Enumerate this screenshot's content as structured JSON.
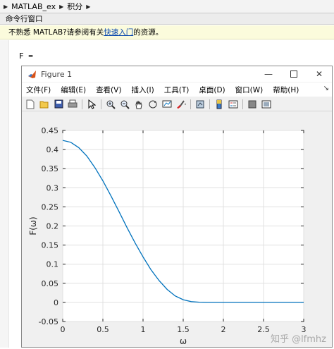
{
  "breadcrumb": {
    "items": [
      "MATLAB_ex",
      "积分"
    ]
  },
  "command_window": {
    "title": "命令行窗口",
    "hint_prefix": "不熟悉 MATLAB?请参阅有关",
    "hint_link": "快速入门",
    "hint_suffix": "的资源。",
    "output_line": "F ="
  },
  "figure": {
    "title": "Figure 1",
    "menu": [
      "文件(F)",
      "编辑(E)",
      "查看(V)",
      "插入(I)",
      "工具(T)",
      "桌面(D)",
      "窗口(W)",
      "帮助(H)"
    ],
    "toolbar_icons": [
      "new-file-icon",
      "open-icon",
      "save-icon",
      "print-icon",
      "pointer-icon",
      "zoom-in-icon",
      "zoom-out-icon",
      "pan-icon",
      "rotate-icon",
      "data-cursor-icon",
      "brush-icon",
      "link-plot-icon",
      "colorbar-icon",
      "legend-icon",
      "hide-plot-tools-icon",
      "show-plot-tools-icon"
    ]
  },
  "watermark": "知乎 @lfmhz",
  "colors": {
    "line": "#0072bd",
    "grid": "#e0e0e0"
  },
  "chart_data": {
    "type": "line",
    "xlabel": "ω",
    "ylabel": "F(ω)",
    "xlim": [
      0,
      3
    ],
    "ylim": [
      -0.05,
      0.45
    ],
    "xticks": [
      "0",
      "0.5",
      "1",
      "1.5",
      "2",
      "2.5",
      "3"
    ],
    "yticks": [
      "-0.05",
      "0",
      "0.05",
      "0.1",
      "0.15",
      "0.2",
      "0.25",
      "0.3",
      "0.35",
      "0.4",
      "0.45"
    ],
    "grid": true,
    "series": [
      {
        "x": [
          0,
          0.1,
          0.2,
          0.3,
          0.4,
          0.5,
          0.6,
          0.7,
          0.8,
          0.9,
          1.0,
          1.1,
          1.2,
          1.3,
          1.4,
          1.5,
          1.6,
          1.7,
          1.8,
          1.9,
          2.0,
          2.5,
          3.0
        ],
        "y": [
          0.424,
          0.419,
          0.405,
          0.383,
          0.353,
          0.318,
          0.279,
          0.238,
          0.196,
          0.156,
          0.119,
          0.085,
          0.057,
          0.034,
          0.017,
          0.007,
          0.002,
          0.0005,
          0.0,
          0.0,
          0.0,
          0.0,
          0.0
        ]
      }
    ]
  }
}
